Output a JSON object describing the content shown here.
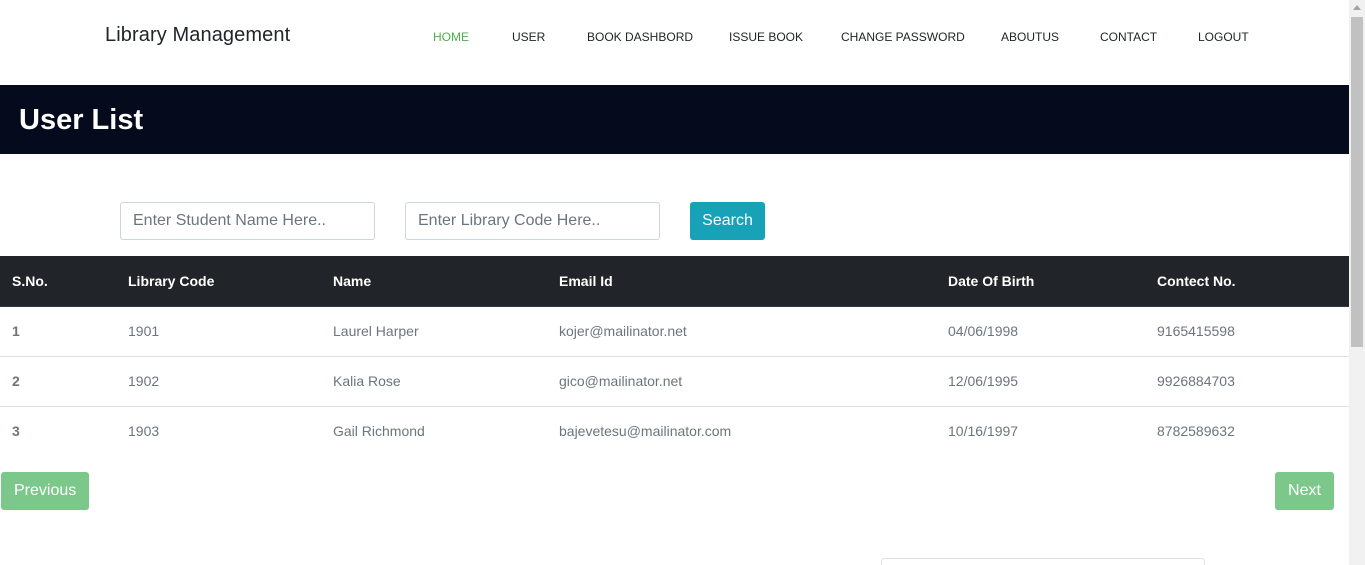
{
  "navbar": {
    "brand": "Library Management",
    "items": [
      {
        "label": "HOME",
        "active": true
      },
      {
        "label": "USER",
        "active": false
      },
      {
        "label": "BOOK DASHBORD",
        "active": false
      },
      {
        "label": "ISSUE BOOK",
        "active": false
      },
      {
        "label": "CHANGE PASSWORD",
        "active": false
      },
      {
        "label": "ABOUTUS",
        "active": false
      },
      {
        "label": "CONTACT",
        "active": false
      },
      {
        "label": "LOGOUT",
        "active": false
      }
    ]
  },
  "header": {
    "title": "User List"
  },
  "search": {
    "name_placeholder": "Enter Student Name Here..",
    "name_value": "",
    "code_placeholder": "Enter Library Code Here..",
    "code_value": "",
    "button_label": "Search"
  },
  "table": {
    "columns": [
      "S.No.",
      "Library Code",
      "Name",
      "Email Id",
      "Date Of Birth",
      "Contect No."
    ],
    "rows": [
      [
        "1",
        "1901",
        "Laurel Harper",
        "kojer@mailinator.net",
        "04/06/1998",
        "9165415598"
      ],
      [
        "2",
        "1902",
        "Kalia Rose",
        "gico@mailinator.net",
        "12/06/1995",
        "9926884703"
      ],
      [
        "3",
        "1903",
        "Gail Richmond",
        "bajevetesu@mailinator.com",
        "10/16/1997",
        "8782589632"
      ]
    ]
  },
  "pagination": {
    "previous_label": "Previous",
    "next_label": "Next"
  },
  "colors": {
    "nav_active": "#4caf50",
    "header_bg": "#050a1c",
    "search_button": "#17a2b8",
    "table_header_bg": "#212529",
    "pagination_button": "#7cc88a"
  }
}
